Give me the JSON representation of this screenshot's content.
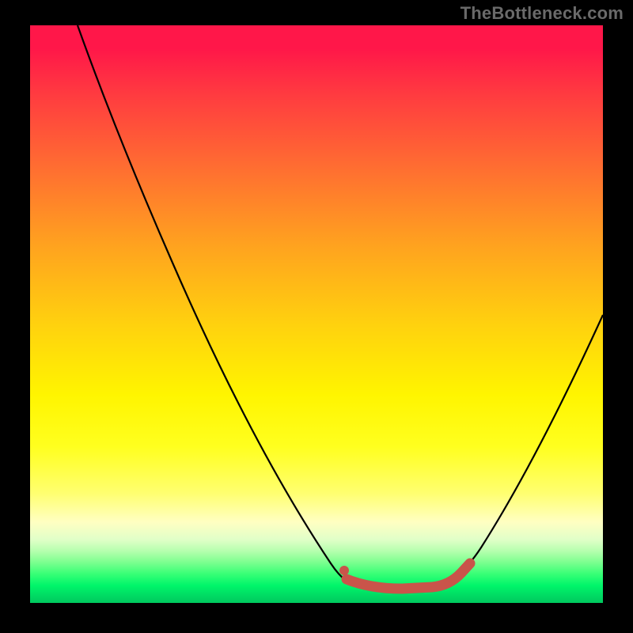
{
  "watermark": "TheBottleneck.com",
  "colors": {
    "background": "#000000",
    "curve": "#000000",
    "highlight": "#c9544a",
    "gradient_top": "#ff1749",
    "gradient_mid": "#fff500",
    "gradient_bottom": "#00c85e"
  },
  "chart_data": {
    "type": "line",
    "title": "",
    "xlabel": "",
    "ylabel": "",
    "xlim": [
      0,
      100
    ],
    "ylim": [
      0,
      100
    ],
    "series": [
      {
        "name": "bottleneck-curve",
        "x": [
          8,
          15,
          25,
          35,
          45,
          53,
          55,
          58,
          64,
          70,
          74,
          78,
          85,
          92,
          100
        ],
        "y": [
          100,
          82,
          60,
          40,
          22,
          8,
          3,
          2,
          2,
          3,
          6,
          12,
          25,
          38,
          50
        ]
      }
    ],
    "highlight_range": {
      "name": "optimal-range",
      "x": [
        55,
        77
      ],
      "y_at_ends": [
        5,
        7
      ],
      "color": "#c9544a"
    },
    "marker": {
      "name": "marker-start",
      "x": 55,
      "y": 5,
      "color": "#c9544a"
    },
    "background_scale": {
      "description": "vertical gradient red(top)=high mismatch, green(bottom)=balanced",
      "stops": [
        {
          "pos": 0.0,
          "color": "#ff1749"
        },
        {
          "pos": 0.5,
          "color": "#ffd20e"
        },
        {
          "pos": 0.7,
          "color": "#ffff1f"
        },
        {
          "pos": 0.9,
          "color": "#b6ffae"
        },
        {
          "pos": 1.0,
          "color": "#00c85e"
        }
      ]
    }
  }
}
